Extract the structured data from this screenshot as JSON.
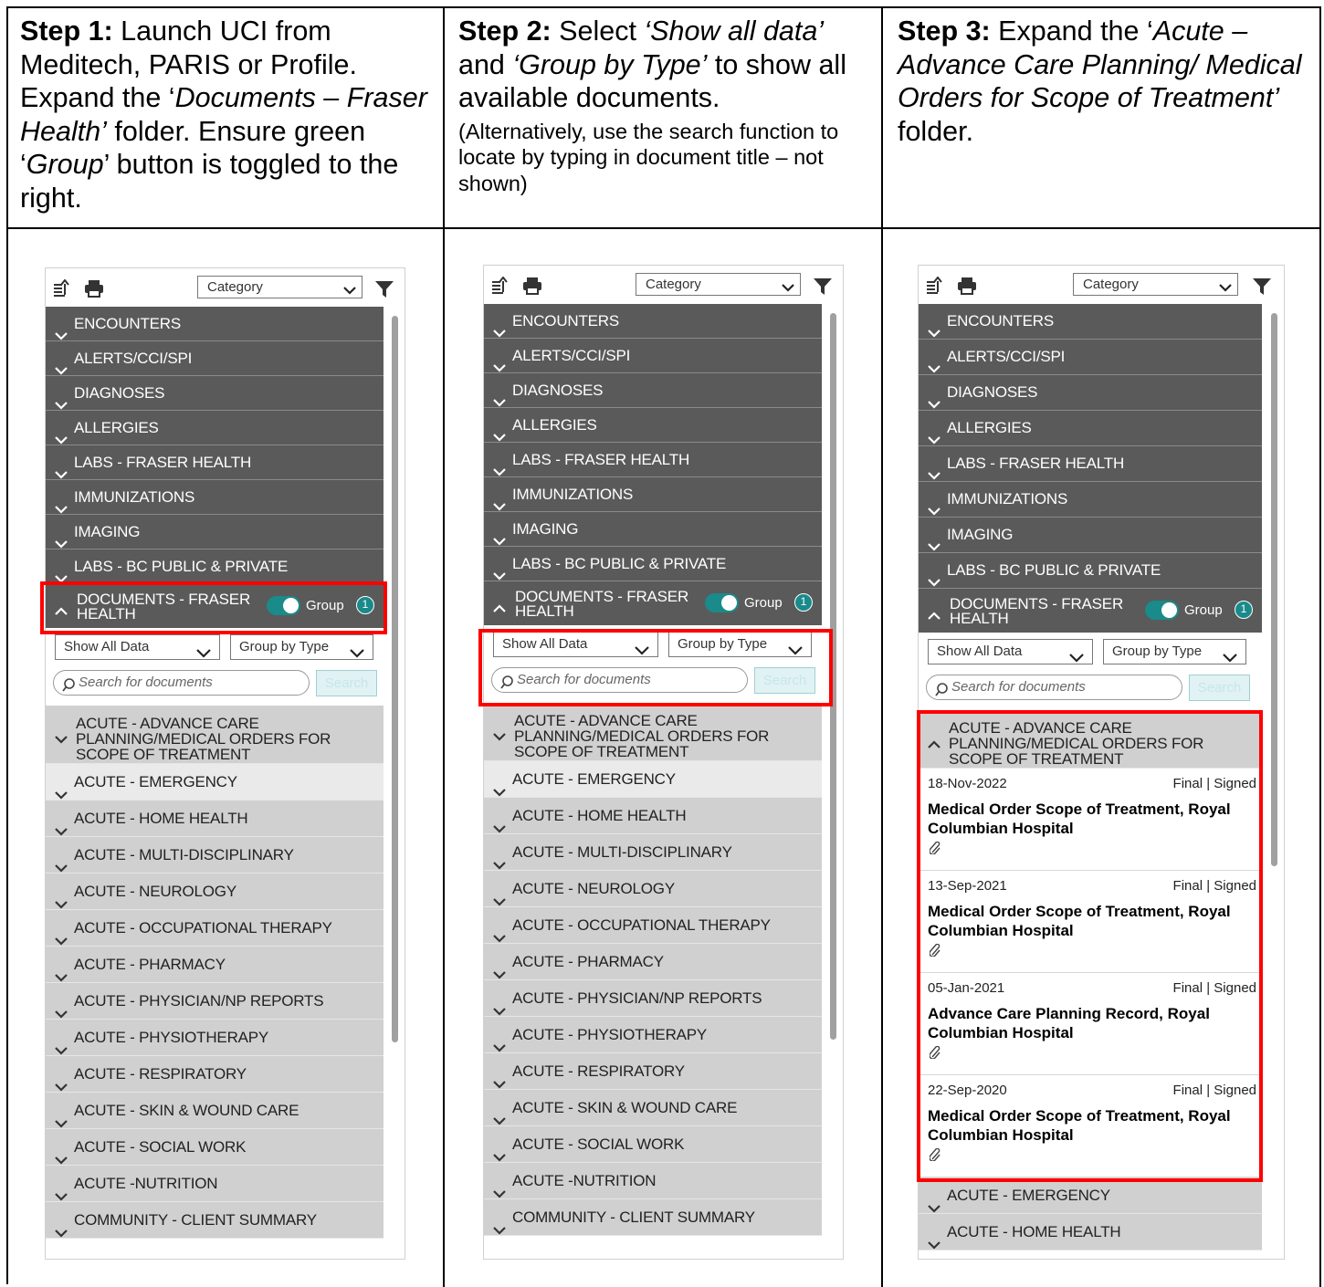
{
  "steps": [
    {
      "lead": "Step 1:",
      "text": [
        {
          "t": " Launch UCI from Meditech, PARIS or Profile. Expand the ‘",
          "i": false
        },
        {
          "t": "Documents – Fraser Health’",
          "i": true
        },
        {
          "t": " folder. Ensure green ‘",
          "i": false
        },
        {
          "t": "Group",
          "i": true
        },
        {
          "t": "’ button is toggled to the right.",
          "i": false
        }
      ],
      "note": ""
    },
    {
      "lead": "Step 2:",
      "text": [
        {
          "t": " Select ",
          "i": false
        },
        {
          "t": "‘Show all data’",
          "i": true
        },
        {
          "t": " and ",
          "i": false
        },
        {
          "t": "‘Group by Type’",
          "i": true
        },
        {
          "t": " to show all available documents.",
          "i": false
        }
      ],
      "note": "(Alternatively, use the search function to locate by typing in document title – not shown)"
    },
    {
      "lead": "Step 3:",
      "text": [
        {
          "t": " Expand the ‘",
          "i": false
        },
        {
          "t": "Acute – Advance Care Planning/ Medical Orders for Scope of Treatment’",
          "i": true
        },
        {
          "t": " folder.",
          "i": false
        }
      ],
      "note": ""
    }
  ],
  "toolbar": {
    "category": "Category"
  },
  "categories": [
    "ENCOUNTERS",
    "ALERTS/CCI/SPI",
    "DIAGNOSES",
    "ALLERGIES",
    "LABS - FRASER HEALTH",
    "IMMUNIZATIONS",
    "IMAGING",
    "LABS - BC PUBLIC & PRIVATE"
  ],
  "documents_folder": {
    "line1": "DOCUMENTS - FRASER",
    "line2": "HEALTH",
    "group_label": "Group",
    "badge": "1"
  },
  "filters": {
    "show": "Show All Data",
    "group": "Group by Type",
    "search_placeholder": "Search for documents",
    "search_button": "Search"
  },
  "acp_folder": {
    "line1": "ACUTE - ADVANCE CARE",
    "line2": "PLANNING/MEDICAL ORDERS FOR",
    "line3": "SCOPE OF TREATMENT"
  },
  "subfolders": [
    "ACUTE - EMERGENCY",
    "ACUTE - HOME HEALTH",
    "ACUTE - MULTI-DISCIPLINARY",
    "ACUTE - NEUROLOGY",
    "ACUTE - OCCUPATIONAL THERAPY",
    "ACUTE - PHARMACY",
    "ACUTE - PHYSICIAN/NP REPORTS",
    "ACUTE - PHYSIOTHERAPY",
    "ACUTE - RESPIRATORY",
    "ACUTE - SKIN & WOUND CARE",
    "ACUTE - SOCIAL WORK",
    "ACUTE -NUTRITION",
    "COMMUNITY - CLIENT SUMMARY"
  ],
  "docs": [
    {
      "date": "18-Nov-2022",
      "status": "Final | Signed",
      "title": "Medical Order Scope of Treatment, Royal Columbian Hospital"
    },
    {
      "date": "13-Sep-2021",
      "status": "Final | Signed",
      "title": "Medical Order Scope of Treatment, Royal Columbian Hospital"
    },
    {
      "date": "05-Jan-2021",
      "status": "Final | Signed",
      "title": "Advance Care Planning Record, Royal Columbian Hospital"
    },
    {
      "date": "22-Sep-2020",
      "status": "Final | Signed",
      "title": "Medical Order Scope of Treatment, Royal Columbian Hospital"
    }
  ],
  "step3_tail": [
    "ACUTE - EMERGENCY",
    "ACUTE - HOME HEALTH"
  ]
}
